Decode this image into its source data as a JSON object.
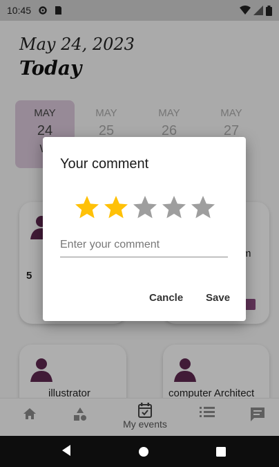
{
  "status_bar": {
    "time": "10:45"
  },
  "header": {
    "date": "May 24, 2023",
    "subtitle": "Today"
  },
  "days": [
    {
      "month": "MAY",
      "day": "24",
      "weekday": "W"
    },
    {
      "month": "MAY",
      "day": "25"
    },
    {
      "month": "MAY",
      "day": "26"
    },
    {
      "month": "MAY",
      "day": "27"
    }
  ],
  "cards": [
    {
      "rating": "5"
    },
    {
      "label_partial": "m"
    },
    {
      "label": "illustrator"
    },
    {
      "label": "computer Architect"
    }
  ],
  "bottom_nav": {
    "home_icon": "home-icon",
    "categories_icon": "shapes-icon",
    "my_events_label": "My events",
    "list_icon": "list-icon",
    "chat_icon": "chat-icon"
  },
  "dialog": {
    "title": "Your comment",
    "rating": 2,
    "max_rating": 5,
    "comment_placeholder": "Enter your comment",
    "comment_value": "",
    "cancel_label": "Cancle",
    "save_label": "Save"
  },
  "colors": {
    "star_active": "#FFC107",
    "star_inactive": "#9E9E9E",
    "accent": "#5e2750",
    "selected_day_bg": "#d8c6d8"
  }
}
